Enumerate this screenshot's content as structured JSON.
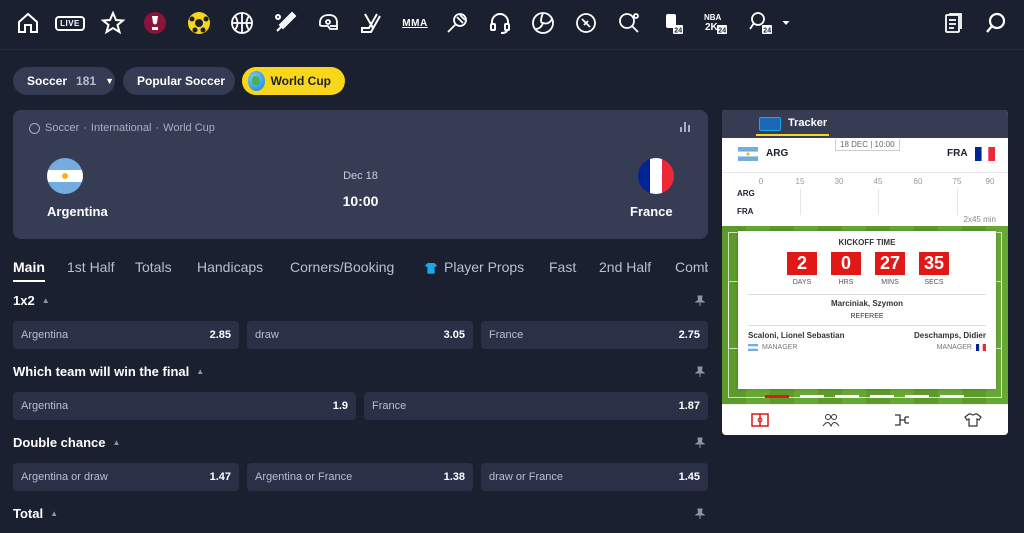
{
  "nav": {
    "icons": [
      "home-icon",
      "live-icon",
      "star-icon",
      "world-cup-icon",
      "soccer-ball-icon",
      "basketball-icon",
      "baseball-icon",
      "american-football-helmet-icon",
      "hockey-icon",
      "mma-icon",
      "tennis-icon",
      "esports-headset-icon",
      "volleyball-icon",
      "rugby-icon",
      "table-tennis-icon",
      "fifa-24-icon",
      "nba-2k24-icon",
      "racket-24-icon",
      "more-chevron-icon",
      "betslip-icon",
      "search-icon"
    ],
    "live_label": "LIVE",
    "mma_label": "MMA",
    "nba_label": "NBA\n2K"
  },
  "filters": {
    "sport_label": "Soccer",
    "sport_count": "181",
    "popular_label": "Popular Soccer",
    "worldcup_label": "World Cup"
  },
  "match": {
    "breadcrumb": [
      "Soccer",
      "International",
      "World Cup"
    ],
    "home": "Argentina",
    "away": "France",
    "date": "Dec 18",
    "time": "10:00"
  },
  "tabs": [
    "Main",
    "1st Half",
    "Totals",
    "Handicaps",
    "Corners/Booking",
    "Player Props",
    "Fast",
    "2nd Half",
    "Combos"
  ],
  "markets": [
    {
      "title": "1x2",
      "odds": [
        {
          "label": "Argentina",
          "value": "2.85"
        },
        {
          "label": "draw",
          "value": "3.05"
        },
        {
          "label": "France",
          "value": "2.75"
        }
      ]
    },
    {
      "title": "Which team will win the final",
      "odds": [
        {
          "label": "Argentina",
          "value": "1.9"
        },
        {
          "label": "France",
          "value": "1.87"
        }
      ]
    },
    {
      "title": "Double chance",
      "odds": [
        {
          "label": "Argentina or draw",
          "value": "1.47"
        },
        {
          "label": "Argentina or France",
          "value": "1.38"
        },
        {
          "label": "draw or France",
          "value": "1.45"
        }
      ]
    },
    {
      "title": "Total",
      "odds": []
    }
  ],
  "tracker": {
    "title": "Tracker",
    "date": "18 DEC | 10:00",
    "home_abbr": "ARG",
    "away_abbr": "FRA",
    "timeline_ticks": [
      "0",
      "15",
      "30",
      "45",
      "60",
      "75",
      "90"
    ],
    "timeline_unit": "2x45 min",
    "kickoff_title": "KICKOFF TIME",
    "countdown": [
      {
        "value": "2",
        "label": "DAYS"
      },
      {
        "value": "0",
        "label": "HRS"
      },
      {
        "value": "27",
        "label": "MINS"
      },
      {
        "value": "35",
        "label": "SECS"
      }
    ],
    "referee_name": "Marciniak, Szymon",
    "referee_role": "REFEREE",
    "home_manager": "Scaloni, Lionel Sebastian",
    "away_manager": "Deschamps, Didier",
    "manager_role": "MANAGER",
    "footer_icons": [
      "pitch-view-icon",
      "lineups-icon",
      "bracket-icon",
      "shirt-icon"
    ]
  },
  "colors": {
    "accent": "#f7d61b",
    "background": "#1b2031",
    "card": "#353c54",
    "odd_button": "#2a3046",
    "countdown": "#e01818"
  }
}
